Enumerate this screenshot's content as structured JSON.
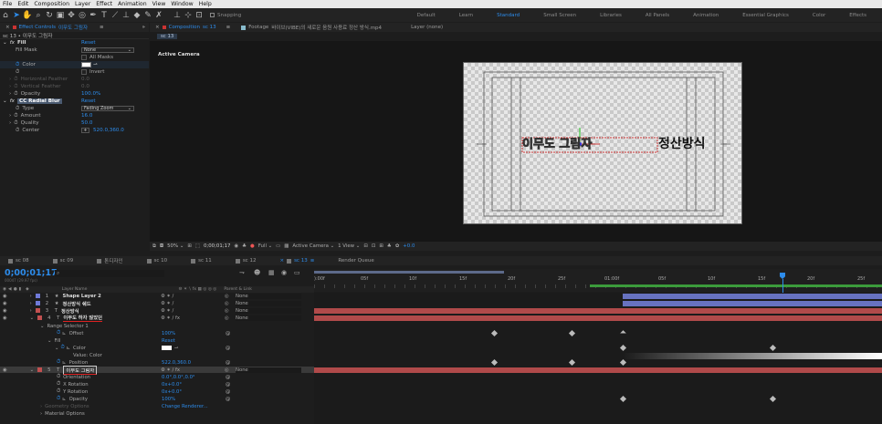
{
  "menu": [
    "File",
    "Edit",
    "Composition",
    "Layer",
    "Effect",
    "Animation",
    "View",
    "Window",
    "Help"
  ],
  "toolbar": {
    "snapping_label": "Snapping",
    "workspaces": [
      "Default",
      "Learn",
      "Standard",
      "Small Screen",
      "Libraries",
      "All Panels",
      "Animation",
      "Essential Graphics",
      "Color",
      "Effects"
    ],
    "active_workspace": "Standard"
  },
  "effect_controls": {
    "tab_label": "Effect Controls",
    "tab_layer": "이무도 그림자",
    "breadcrumb": "sc 13 • 이무도 그림자",
    "fill": {
      "name": "Fill",
      "reset": "Reset",
      "fill_mask_label": "Fill Mask",
      "fill_mask_value": "None",
      "all_masks": "All Masks",
      "color_label": "Color",
      "invert": "Invert",
      "h_feather": "Horizontal Feather",
      "h_feather_val": "0.0",
      "v_feather": "Vertical Feather",
      "v_feather_val": "0.0",
      "opacity_label": "Opacity",
      "opacity_val": "100.0%"
    },
    "blur": {
      "name": "CC Radial Blur",
      "reset": "Reset",
      "type_label": "Type",
      "type_val": "Fading Zoom",
      "amount_label": "Amount",
      "amount_val": "16.0",
      "quality_label": "Quality",
      "quality_val": "50.0",
      "center_label": "Center",
      "center_val": "520.0,360.0"
    }
  },
  "composition": {
    "tab_label": "Composition",
    "tab_name": "sc 13",
    "footage_label": "Footage",
    "footage_name": "바이브(VIBE)의 새로운 음원 사용료 정산 방식.mp4",
    "layer_label": "Layer (none)",
    "subtab": "sc 13",
    "active_camera": "Active Camera",
    "comp_text": "이무도 그림자 정산방식",
    "comp_text_strong": "정산방식",
    "comp_text_ghost": "이무도 그림자",
    "zoom": "50%",
    "timecode": "0;00;01;17",
    "resolution": "Full",
    "camera": "Active Camera",
    "view": "1 View",
    "exposure": "+0.0"
  },
  "timeline": {
    "tabs": [
      "sc 08",
      "sc 09",
      "톤디자인",
      "sc 10",
      "sc 11",
      "sc 12",
      "sc 13",
      "Render Queue"
    ],
    "active_tab": "sc 13",
    "timecode": "0;00;01;17",
    "frames": "00047 (29.97 fps)",
    "col_layer_name": "Layer Name",
    "col_parent": "Parent & Link",
    "ruler": [
      "):00f",
      "05f",
      "10f",
      "15f",
      "20f",
      "25f",
      "01:00f",
      "05f",
      "10f",
      "15f",
      "20f",
      "25f"
    ],
    "layers": [
      {
        "num": "1",
        "type": "★",
        "name": "Shape Layer 2",
        "parent": "None",
        "color": "#6f7ad8"
      },
      {
        "num": "2",
        "type": "★",
        "name": "정산방식 쉐드",
        "parent": "None",
        "color": "#6f7ad8"
      },
      {
        "num": "3",
        "type": "T",
        "name": "정산방식",
        "parent": "None",
        "color": "#c25050"
      },
      {
        "num": "4",
        "type": "T",
        "name": "이무도 하자 않았던",
        "parent": "None",
        "color": "#c25050"
      },
      {
        "num": "5",
        "type": "T",
        "name": "이무도 그림자",
        "parent": "None",
        "color": "#c25050"
      }
    ],
    "props": {
      "range_selector": "Range Selector 1",
      "offset": "Offset",
      "offset_val": "100%",
      "fill": "Fill",
      "fill_reset": "Reset",
      "color": "Color",
      "value_color": "Value: Color",
      "position": "Position",
      "position_val": "522.0,360.0",
      "orientation": "Orientation",
      "orientation_val": "0.0°,0.0°,0.0°",
      "x_rotation": "X Rotation",
      "x_rotation_val": "0x+0.0°",
      "y_rotation": "Y Rotation",
      "y_rotation_val": "0x+0.0°",
      "opacity": "Opacity",
      "opacity_val": "100%",
      "geometry": "Geometry Options",
      "geometry_val": "Change Renderer...",
      "material": "Material Options"
    }
  }
}
